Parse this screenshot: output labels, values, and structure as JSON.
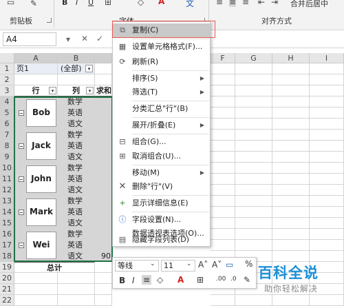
{
  "ribbon": {
    "groups": [
      "剪贴板",
      "字体",
      "对齐方式"
    ],
    "merge_button": "合并后居中",
    "bold": "B",
    "italic": "I",
    "underline": "U"
  },
  "formula_bar": {
    "name_box": "A4"
  },
  "columns": [
    "A",
    "B",
    "C",
    "D",
    "E",
    "F",
    "G",
    "H",
    "I"
  ],
  "rows": [
    "1",
    "2",
    "3",
    "4",
    "5",
    "6",
    "7",
    "8",
    "9",
    "10",
    "11",
    "12",
    "13",
    "14",
    "15",
    "16",
    "17",
    "18",
    "19",
    "20",
    "21",
    "22"
  ],
  "pivot": {
    "page_label": "页1",
    "page_value": "(全部)",
    "row_header": "行",
    "col_header": "列",
    "sum_header": "求和",
    "total_label": "总计",
    "last_value": "90",
    "names": [
      "Bob",
      "Jack",
      "John",
      "Mark",
      "Wei"
    ],
    "subjects": [
      "数学",
      "英语",
      "语文"
    ]
  },
  "context_menu": {
    "items": [
      {
        "label": "复制(C)",
        "icon": "copy-icon"
      },
      {
        "label": "设置单元格格式(F)...",
        "icon": "format-cells-icon"
      },
      {
        "label": "刷新(R)",
        "icon": "refresh-icon"
      },
      {
        "label": "排序(S)",
        "icon": ""
      },
      {
        "label": "筛选(T)",
        "icon": ""
      },
      {
        "label": "分类汇总\"行\"(B)",
        "icon": ""
      },
      {
        "label": "展开/折叠(E)",
        "icon": ""
      },
      {
        "label": "组合(G)...",
        "icon": "group-icon"
      },
      {
        "label": "取消组合(U)...",
        "icon": "ungroup-icon"
      },
      {
        "label": "移动(M)",
        "icon": ""
      },
      {
        "label": "删除\"行\"(V)",
        "icon": "delete-icon"
      },
      {
        "label": "显示详细信息(E)",
        "icon": "show-details-icon"
      },
      {
        "label": "字段设置(N)...",
        "icon": "field-settings-icon"
      },
      {
        "label": "数据透视表选项(O)...",
        "icon": ""
      },
      {
        "label": "隐藏字段列表(D)",
        "icon": "field-list-icon"
      }
    ]
  },
  "mini_toolbar": {
    "font": "等线",
    "size": "11",
    "percent": "%"
  },
  "watermark": {
    "title": "百科全说",
    "subtitle": "助你轻松解决"
  }
}
